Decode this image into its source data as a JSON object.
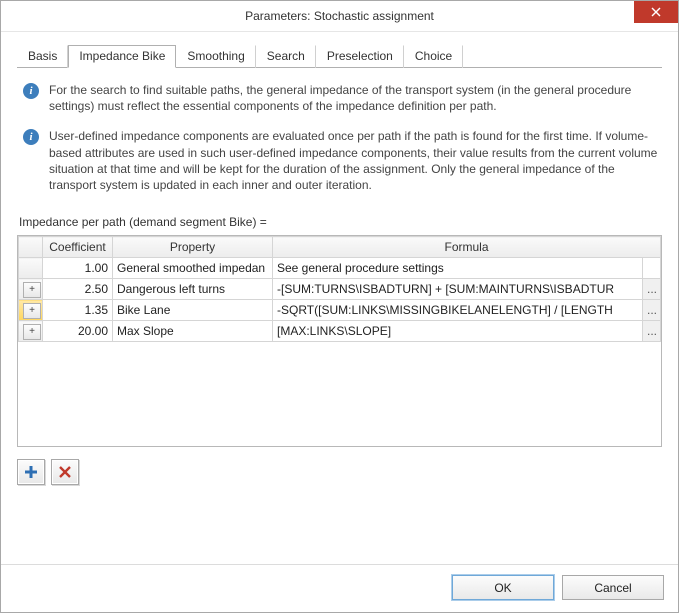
{
  "title": "Parameters: Stochastic assignment",
  "tabs": [
    "Basis",
    "Impedance Bike",
    "Smoothing",
    "Search",
    "Preselection",
    "Choice"
  ],
  "active_tab_index": 1,
  "info1": "For the search to find suitable paths, the general impedance of the transport system (in the general procedure settings) must reflect the essential components of the impedance definition per path.",
  "info2": "User-defined impedance components are evaluated once per path if the path is found for the first time. If volume-based attributes are used in such user-defined impedance components, their value results from the current volume situation at that time and will be kept for the duration of the assignment. Only the general impedance of the transport system is updated in each inner and outer iteration.",
  "section_label": "Impedance per path (demand segment Bike) =",
  "columns": [
    "Coefficient",
    "Property",
    "Formula"
  ],
  "rows": [
    {
      "plus": false,
      "coef": "1.00",
      "prop": "General smoothed impedan",
      "formula": "See general procedure settings",
      "ellipsis": false,
      "selected": false
    },
    {
      "plus": true,
      "coef": "2.50",
      "prop": "Dangerous left turns",
      "formula": "-[SUM:TURNS\\ISBADTURN] + [SUM:MAINTURNS\\ISBADTUR",
      "ellipsis": true,
      "selected": false
    },
    {
      "plus": true,
      "coef": "1.35",
      "prop": "Bike Lane",
      "formula": "-SQRT([SUM:LINKS\\MISSINGBIKELANELENGTH] / [LENGTH",
      "ellipsis": true,
      "selected": true
    },
    {
      "plus": true,
      "coef": "20.00",
      "prop": "Max Slope",
      "formula": "[MAX:LINKS\\SLOPE]",
      "ellipsis": true,
      "selected": false
    }
  ],
  "footer": {
    "ok": "OK",
    "cancel": "Cancel"
  }
}
